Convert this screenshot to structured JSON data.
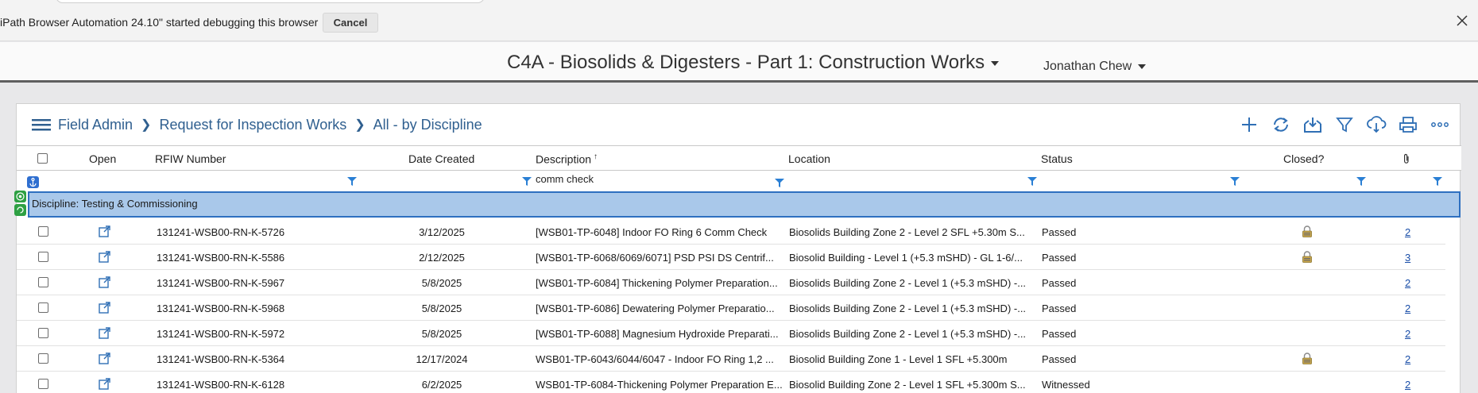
{
  "debug_banner": {
    "message": "iPath Browser Automation 24.10\" started debugging this browser",
    "cancel_label": "Cancel"
  },
  "header": {
    "project_title": "C4A - Biosolids & Digesters - Part 1: Construction Works",
    "user_name": "Jonathan Chew"
  },
  "breadcrumb": {
    "items": [
      "Field Admin",
      "Request for Inspection Works",
      "All - by Discipline"
    ]
  },
  "toolbar": {
    "icons": [
      "add-icon",
      "refresh-icon",
      "import-icon",
      "filter-icon",
      "cloud-download-icon",
      "print-icon",
      "more-icon"
    ]
  },
  "grid": {
    "columns": {
      "open": "Open",
      "rfiw_number": "RFIW Number",
      "date_created": "Date Created",
      "description": "Description",
      "sort_indicator": "↑",
      "location": "Location",
      "status": "Status",
      "closed": "Closed?"
    },
    "filters": {
      "description": "comm check"
    },
    "group_label": "Discipline: Testing & Commissioning",
    "rows": [
      {
        "rfiw": "131241-WSB00-RN-K-5726",
        "date": "3/12/2025",
        "description": "[WSB01-TP-6048] Indoor FO Ring 6 Comm Check",
        "location": "Biosolids Building Zone 2 - Level 2 SFL +5.30m S...",
        "status": "Passed",
        "closed": true,
        "attachments": "2"
      },
      {
        "rfiw": "131241-WSB00-RN-K-5586",
        "date": "2/12/2025",
        "description": "[WSB01-TP-6068/6069/6071] PSD PSI DS Centrif...",
        "location": "Biosolid Building - Level 1 (+5.3 mSHD) - GL 1-6/...",
        "status": "Passed",
        "closed": true,
        "attachments": "3"
      },
      {
        "rfiw": "131241-WSB00-RN-K-5967",
        "date": "5/8/2025",
        "description": "[WSB01-TP-6084] Thickening Polymer Preparation...",
        "location": "Biosolids Building Zone 2 - Level 1 (+5.3 mSHD) -...",
        "status": "Passed",
        "closed": false,
        "attachments": "2"
      },
      {
        "rfiw": "131241-WSB00-RN-K-5968",
        "date": "5/8/2025",
        "description": "[WSB01-TP-6086] Dewatering Polymer Preparatio...",
        "location": "Biosolids Building Zone 2 - Level 1 (+5.3 mSHD) -...",
        "status": "Passed",
        "closed": false,
        "attachments": "2"
      },
      {
        "rfiw": "131241-WSB00-RN-K-5972",
        "date": "5/8/2025",
        "description": "[WSB01-TP-6088] Magnesium Hydroxide Preparati...",
        "location": "Biosolids Building Zone 2 - Level 1 (+5.3 mSHD) -...",
        "status": "Passed",
        "closed": false,
        "attachments": "2"
      },
      {
        "rfiw": "131241-WSB00-RN-K-5364",
        "date": "12/17/2024",
        "description": "WSB01-TP-6043/6044/6047 - Indoor FO Ring 1,2 ...",
        "location": "Biosolid Building Zone 1 - Level 1 SFL +5.300m",
        "status": "Passed",
        "closed": true,
        "attachments": "2"
      },
      {
        "rfiw": "131241-WSB00-RN-K-6128",
        "date": "6/2/2025",
        "description": "WSB01-TP-6084-Thickening Polymer Preparation E...",
        "location": "Biosolid Building Zone 2 - Level 1 SFL +5.300m S...",
        "status": "Witnessed",
        "closed": false,
        "attachments": "2"
      }
    ]
  },
  "colors": {
    "link_blue": "#2f5f8f",
    "group_bg": "#a9c8ea",
    "group_border": "#2e6fc0",
    "filter_funnel": "#2a7fd4",
    "badge_green": "#2ea043"
  }
}
